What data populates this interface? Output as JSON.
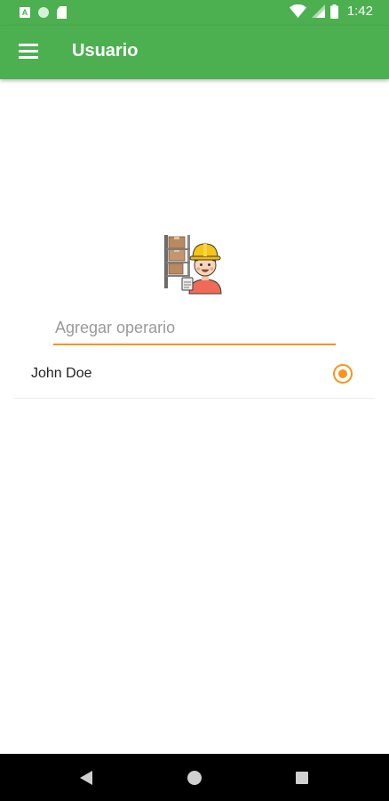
{
  "status_bar": {
    "time": "1:42",
    "left_icons": [
      "app-a-icon",
      "circle-icon",
      "sd-card-icon"
    ],
    "right_icons": [
      "wifi-icon",
      "signal-icon",
      "battery-icon"
    ],
    "app_letter": "A"
  },
  "app_bar": {
    "title": "Usuario",
    "menu_icon": "hamburger-menu-icon",
    "color": "#4CAF50"
  },
  "content": {
    "illustration": "warehouse-worker-icon",
    "input": {
      "placeholder": "Agregar operario",
      "value": ""
    },
    "operators": [
      {
        "name": "John Doe",
        "selected": true
      }
    ],
    "accent_color": "#F7941D"
  },
  "nav_bar": {
    "buttons": [
      "back-icon",
      "home-icon",
      "recents-icon"
    ]
  }
}
